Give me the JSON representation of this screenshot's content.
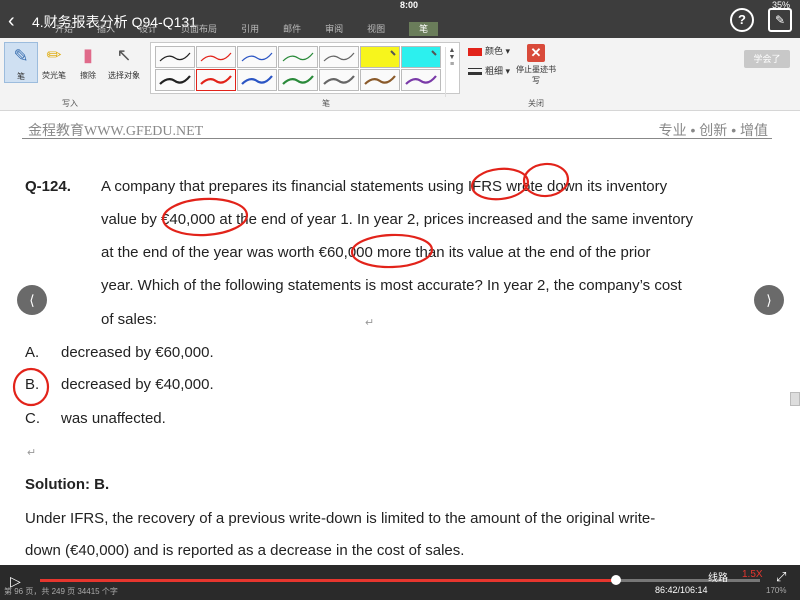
{
  "status": {
    "time": "8:00",
    "battery": "35%"
  },
  "app": {
    "title": "4.财务报表分析 Q94-Q131"
  },
  "ribbon": {
    "tabs": [
      "开始",
      "插入",
      "设计",
      "页面布局",
      "引用",
      "邮件",
      "审阅",
      "视图",
      "笔"
    ],
    "tools": {
      "pen": "笔",
      "highlighter": "荧光笔",
      "eraser": "擦除",
      "select": "选择对象"
    },
    "group_write": "写入",
    "group_pens": "笔",
    "group_close": "关闭",
    "color_label": "颜色",
    "weight_label": "粗细",
    "stop_label": "停止墨迹书写",
    "learned_button": "学会了",
    "colors": {
      "red": "#e2231a",
      "yellow": "#f7f51c",
      "cyan": "#2cf0ee",
      "ribbon_bg": "#f3f3f3"
    }
  },
  "doc": {
    "brand": "金程教育WWW.GFEDU.NET",
    "slogan": "专业 • 创新 • 增值",
    "question_number": "Q-124.",
    "question_lines": [
      "A company that prepares its financial statements using IFRS wrote down its inventory",
      "value by €40,000 at the end of year 1. In year 2, prices increased and the same inventory",
      "at the end of the year was worth €60,000 more than its value at the end of the prior",
      "year. Which of the following statements is most accurate? In year 2, the company’s cost",
      "of sales:"
    ],
    "options": [
      {
        "letter": "A.",
        "text": "decreased by €60,000."
      },
      {
        "letter": "B.",
        "text": "decreased by €40,000."
      },
      {
        "letter": "C.",
        "text": "was unaffected."
      }
    ],
    "para_mark": "↵",
    "solution_title": "Solution: B.",
    "solution_lines": [
      "Under IFRS, the recovery of a previous write-down is limited to the amount of the original write-",
      "down (€40,000) and is reported as a decrease in the cost of sales."
    ]
  },
  "player": {
    "progress": 0.8,
    "line_label": "线路",
    "speed": "1.5X",
    "timecode": "86:42/106:14",
    "docinfo": "第 96 页，共 249 页   34415 个字",
    "zoom": "170%"
  },
  "icons": {
    "back": "back-icon",
    "help": "help-icon",
    "edit": "edit-icon",
    "prev": "prev-page-icon",
    "next": "next-page-icon",
    "play": "play-icon",
    "fullscreen": "fullscreen-icon"
  }
}
